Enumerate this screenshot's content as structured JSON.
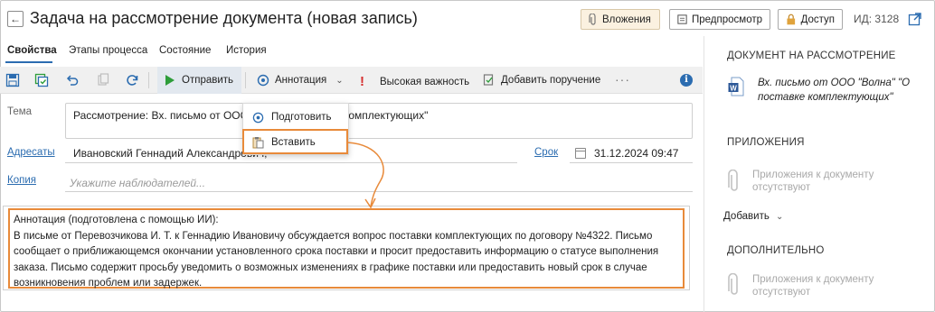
{
  "header": {
    "title": "Задача на рассмотрение документа (новая запись)",
    "attach_label": "Вложения",
    "preview_label": "Предпросмотр",
    "access_label": "Доступ",
    "id_text": "ИД: 3128"
  },
  "tabs": [
    "Свойства",
    "Этапы процесса",
    "Состояние",
    "История"
  ],
  "toolbar": {
    "send_label": "Отправить",
    "annotation_label": "Аннотация",
    "importance_label": "Высокая важность",
    "add_order_label": "Добавить поручение",
    "more": "···",
    "accent": "#2b6cb0",
    "send_color": "#2e9d3a"
  },
  "dropdown": {
    "items": [
      "Подготовить",
      "Вставить"
    ],
    "highlight_color": "#e88a3a"
  },
  "form": {
    "subject_label": "Тема",
    "subject_value": "Рассмотрение: Вх. письмо от ООО",
    "subject_value_tail": "комплектующих\"",
    "addressees_label": "Адресаты",
    "addressees_value": "Ивановский Геннадий Александрович,",
    "deadline_label": "Срок",
    "deadline_value": "31.12.2024 09:47",
    "copy_label": "Копия",
    "copy_placeholder": "Укажите наблюдателей..."
  },
  "annotation": {
    "heading": "Аннотация (подготовлена с помощью ИИ):",
    "body": "В письме от Перевозчикова И. Т. к Геннадию Ивановичу обсуждается вопрос поставки комплектующих по договору №4322. Письмо сообщает о приближающемся окончании установленного срока поставки и просит предоставить информацию о статусе выполнения заказа. Письмо содержит просьбу уведомить о возможных изменениях в графике поставки или предоставить новый срок в случае возникновения проблем или задержек."
  },
  "right_panel": {
    "doc_section": "ДОКУМЕНТ НА РАССМОТРЕНИЕ",
    "doc_title": "Вх. письмо от ООО \"Волна\" \"О поставке комплектующих\"",
    "attachments_section": "ПРИЛОЖЕНИЯ",
    "attachments_empty": "Приложения к документу отсутствуют",
    "add_label": "Добавить",
    "extra_section": "ДОПОЛНИТЕЛЬНО",
    "extra_empty": "Приложения к документу отсутствуют"
  }
}
